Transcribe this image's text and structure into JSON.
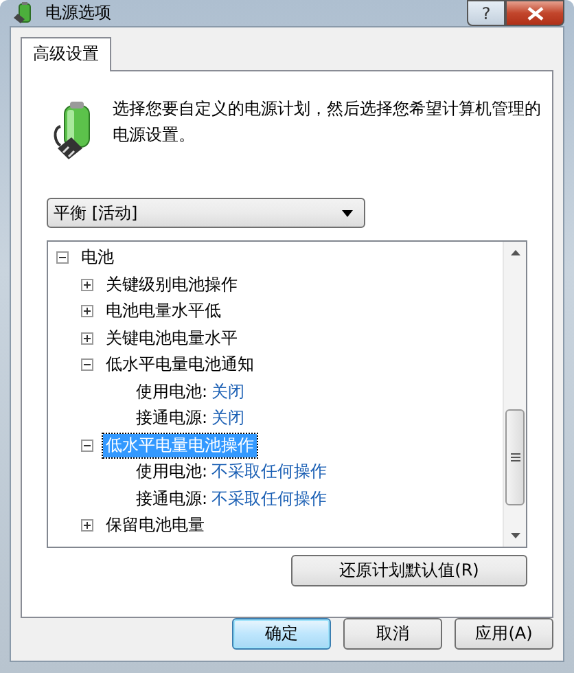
{
  "window": {
    "title": "电源选项",
    "help_button": "?"
  },
  "tabs": [
    {
      "label": "高级设置",
      "selected": true
    }
  ],
  "description": "选择您要自定义的电源计划，然后选择您希望计算机管理的电源设置。",
  "plan_dropdown": {
    "value": "平衡 [活动]"
  },
  "tree": [
    {
      "kind": "group",
      "label": "电池",
      "expanded": true,
      "selected": false,
      "children": [
        {
          "kind": "group",
          "label": "关键级别电池操作",
          "expanded": false,
          "selected": false
        },
        {
          "kind": "group",
          "label": "电池电量水平低",
          "expanded": false,
          "selected": false
        },
        {
          "kind": "group",
          "label": "关键电池电量水平",
          "expanded": false,
          "selected": false
        },
        {
          "kind": "group",
          "label": "低水平电量电池通知",
          "expanded": true,
          "selected": false,
          "children": [
            {
              "kind": "setting",
              "label": "使用电池:",
              "value": "关闭"
            },
            {
              "kind": "setting",
              "label": "接通电源:",
              "value": "关闭"
            }
          ]
        },
        {
          "kind": "group",
          "label": "低水平电量电池操作",
          "expanded": true,
          "selected": true,
          "children": [
            {
              "kind": "setting",
              "label": "使用电池:",
              "value": "不采取任何操作"
            },
            {
              "kind": "setting",
              "label": "接通电源:",
              "value": "不采取任何操作"
            }
          ]
        },
        {
          "kind": "group",
          "label": "保留电池电量",
          "expanded": false,
          "selected": false
        }
      ]
    }
  ],
  "restore_button": "还原计划默认值(R)",
  "buttons": [
    {
      "label": "确定",
      "default": true
    },
    {
      "label": "取消",
      "default": false
    },
    {
      "label": "应用(A)",
      "default": false
    }
  ]
}
